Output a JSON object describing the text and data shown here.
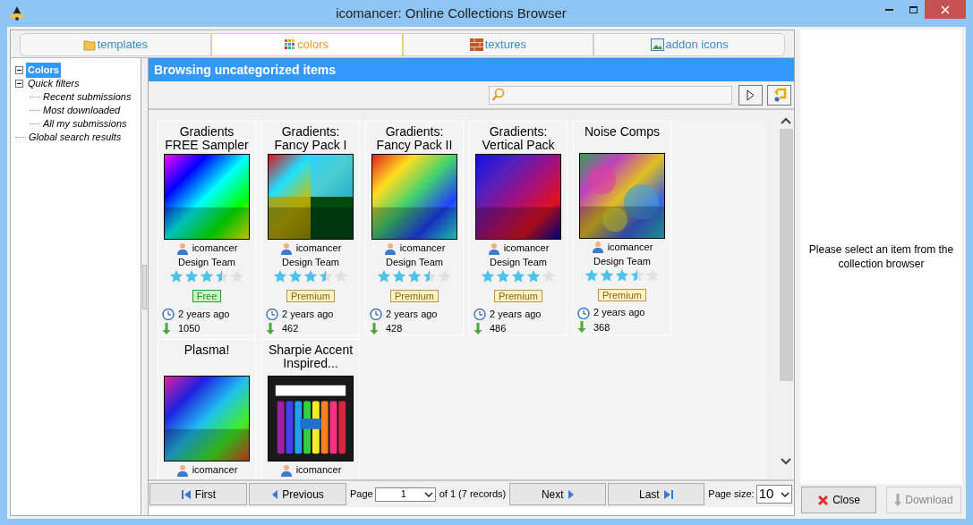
{
  "window": {
    "title": "icomancer: Online Collections Browser"
  },
  "tabs": [
    {
      "label": "templates",
      "selected": false
    },
    {
      "label": "colors",
      "selected": true
    },
    {
      "label": "textures",
      "selected": false
    },
    {
      "label": "addon icons",
      "selected": false
    }
  ],
  "tree": [
    {
      "label": "Colors",
      "selected": true,
      "expanded": true
    },
    {
      "label": "Quick filters",
      "selected": false,
      "expanded": true,
      "children": [
        {
          "label": "Recent submissions",
          "selected": false
        },
        {
          "label": "Most downloaded",
          "selected": false
        },
        {
          "label": "All my submissions",
          "selected": false
        }
      ]
    },
    {
      "label": "Global search results",
      "selected": false
    }
  ],
  "browser": {
    "header": "Browsing uncategorized items",
    "items": [
      {
        "title": "Gradients FREE Sampler",
        "author": "icomancer",
        "team": "Design Team",
        "stars": 3.5,
        "badge": {
          "kind": "free",
          "label": "Free"
        },
        "age": "2 years ago",
        "downloads": "1050"
      },
      {
        "title": "Gradients: Fancy Pack I",
        "author": "icomancer",
        "team": "Design Team",
        "stars": 3.5,
        "badge": {
          "kind": "premium",
          "label": "Premium"
        },
        "age": "2 years ago",
        "downloads": "462"
      },
      {
        "title": "Gradients: Fancy Pack II",
        "author": "icomancer",
        "team": "Design Team",
        "stars": 3.5,
        "badge": {
          "kind": "premium",
          "label": "Premium"
        },
        "age": "2 years ago",
        "downloads": "428"
      },
      {
        "title": "Gradients: Vertical Pack",
        "author": "icomancer",
        "team": "Design Team",
        "stars": 4,
        "badge": {
          "kind": "premium",
          "label": "Premium"
        },
        "age": "2 years ago",
        "downloads": "486"
      },
      {
        "title": "Noise Comps",
        "author": "icomancer",
        "team": "Design Team",
        "stars": 3.5,
        "badge": {
          "kind": "premium",
          "label": "Premium"
        },
        "age": "2 years ago",
        "downloads": "368"
      },
      {
        "title": "Plasma!",
        "author": "icomancer"
      },
      {
        "title": "Sharpie Accent Inspired...",
        "author": "icomancer"
      }
    ],
    "pager": {
      "first": "First",
      "previous": "Previous",
      "page_label": "Page",
      "page": "1",
      "of": "of 1 (7 records)",
      "next": "Next",
      "last": "Last",
      "size_label": "Page size:",
      "size": "10"
    }
  },
  "details": {
    "message": "Please select an item from the collection browser",
    "close": "Close",
    "download": {
      "label": "Download",
      "disabled": true
    }
  }
}
